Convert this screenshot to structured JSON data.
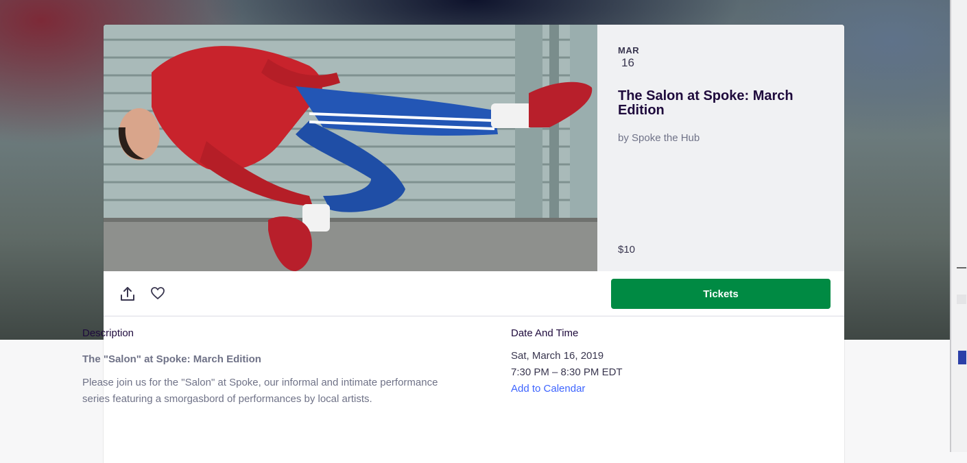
{
  "event": {
    "date_month": "MAR",
    "date_day": "16",
    "title": "The Salon at Spoke: March Edition",
    "organizer": "by Spoke the Hub",
    "price": "$10",
    "hero_image_description": "dancer-photo"
  },
  "actions": {
    "share_icon": "share-icon",
    "like_icon": "heart-icon",
    "tickets_label": "Tickets",
    "tickets_color": "#008a43"
  },
  "description": {
    "label": "Description",
    "title": "The \"Salon\" at Spoke: March Edition",
    "body": "Please join us for the \"Salon\" at Spoke, our informal and intimate performance series featuring a smorgasbord of performances by local artists."
  },
  "date_and_time": {
    "label": "Date And Time",
    "date": "Sat, March 16, 2019",
    "time": "7:30 PM – 8:30 PM EDT",
    "add_to_calendar": "Add to Calendar",
    "link_color": "#3d64ff"
  }
}
